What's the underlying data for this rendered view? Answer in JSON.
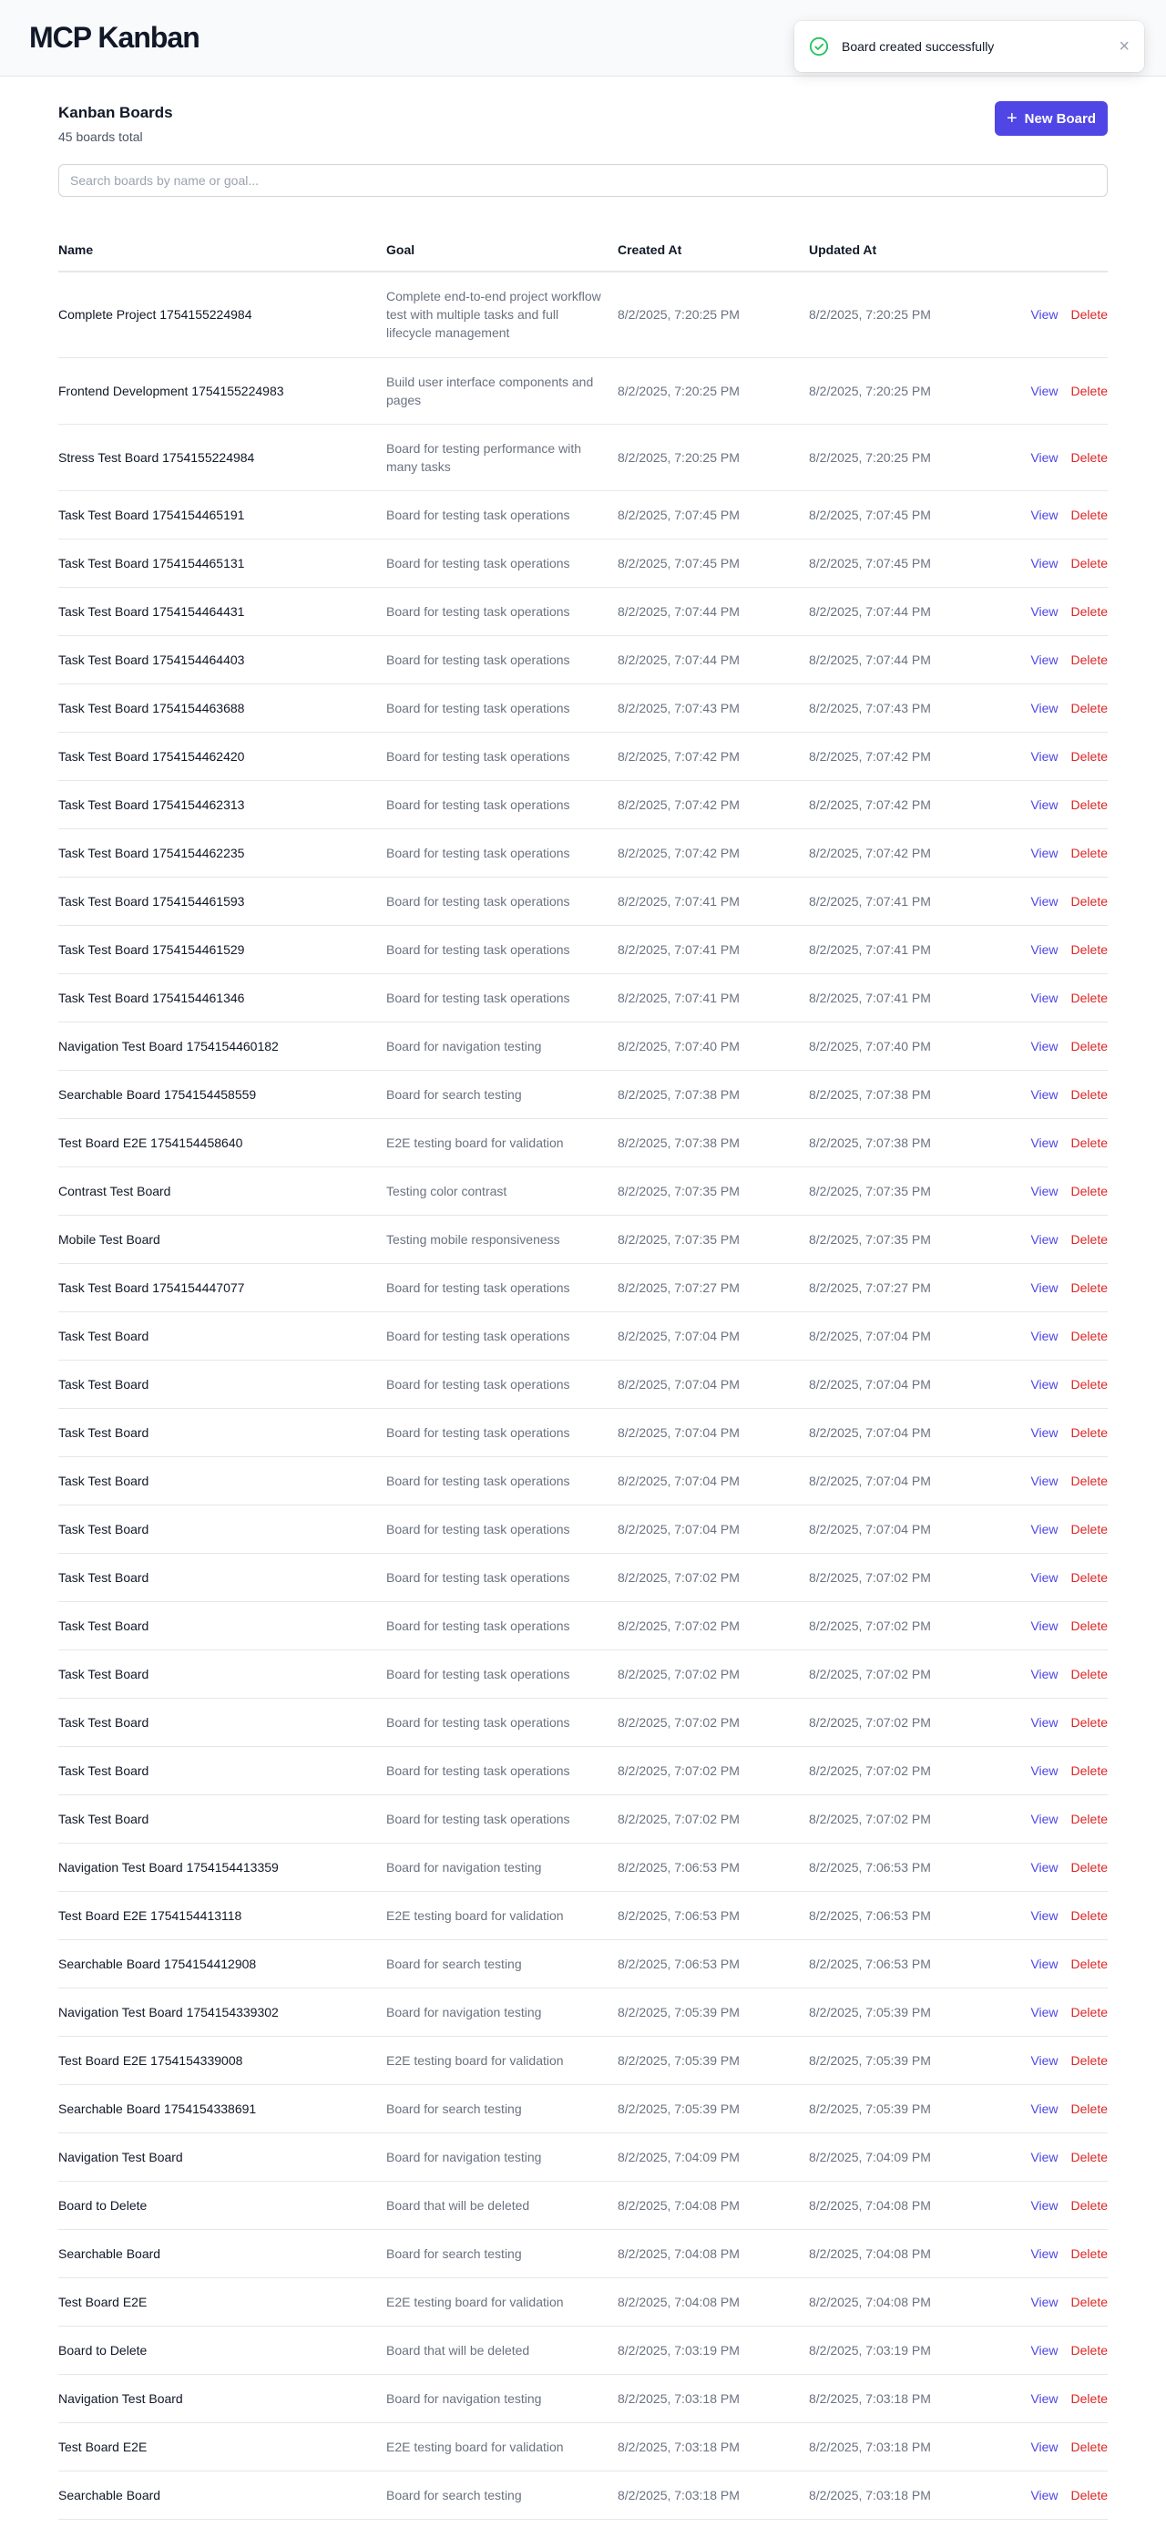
{
  "app": {
    "title": "MCP Kanban"
  },
  "toast": {
    "message": "Board created successfully",
    "close_symbol": "×"
  },
  "page": {
    "title": "Kanban Boards",
    "subtitle": "45 boards total",
    "new_board_label": "New Board"
  },
  "search": {
    "placeholder": "Search boards by name or goal..."
  },
  "table": {
    "columns": [
      "Name",
      "Goal",
      "Created At",
      "Updated At"
    ],
    "action_labels": {
      "view": "View",
      "delete": "Delete"
    },
    "rows": [
      {
        "name": "Complete Project 1754155224984",
        "goal": "Complete end-to-end project workflow test with multiple tasks and full lifecycle management",
        "created": "8/2/2025, 7:20:25 PM",
        "updated": "8/2/2025, 7:20:25 PM"
      },
      {
        "name": "Frontend Development 1754155224983",
        "goal": "Build user interface components and pages",
        "created": "8/2/2025, 7:20:25 PM",
        "updated": "8/2/2025, 7:20:25 PM"
      },
      {
        "name": "Stress Test Board 1754155224984",
        "goal": "Board for testing performance with many tasks",
        "created": "8/2/2025, 7:20:25 PM",
        "updated": "8/2/2025, 7:20:25 PM"
      },
      {
        "name": "Task Test Board 1754154465191",
        "goal": "Board for testing task operations",
        "created": "8/2/2025, 7:07:45 PM",
        "updated": "8/2/2025, 7:07:45 PM"
      },
      {
        "name": "Task Test Board 1754154465131",
        "goal": "Board for testing task operations",
        "created": "8/2/2025, 7:07:45 PM",
        "updated": "8/2/2025, 7:07:45 PM"
      },
      {
        "name": "Task Test Board 1754154464431",
        "goal": "Board for testing task operations",
        "created": "8/2/2025, 7:07:44 PM",
        "updated": "8/2/2025, 7:07:44 PM"
      },
      {
        "name": "Task Test Board 1754154464403",
        "goal": "Board for testing task operations",
        "created": "8/2/2025, 7:07:44 PM",
        "updated": "8/2/2025, 7:07:44 PM"
      },
      {
        "name": "Task Test Board 1754154463688",
        "goal": "Board for testing task operations",
        "created": "8/2/2025, 7:07:43 PM",
        "updated": "8/2/2025, 7:07:43 PM"
      },
      {
        "name": "Task Test Board 1754154462420",
        "goal": "Board for testing task operations",
        "created": "8/2/2025, 7:07:42 PM",
        "updated": "8/2/2025, 7:07:42 PM"
      },
      {
        "name": "Task Test Board 1754154462313",
        "goal": "Board for testing task operations",
        "created": "8/2/2025, 7:07:42 PM",
        "updated": "8/2/2025, 7:07:42 PM"
      },
      {
        "name": "Task Test Board 1754154462235",
        "goal": "Board for testing task operations",
        "created": "8/2/2025, 7:07:42 PM",
        "updated": "8/2/2025, 7:07:42 PM"
      },
      {
        "name": "Task Test Board 1754154461593",
        "goal": "Board for testing task operations",
        "created": "8/2/2025, 7:07:41 PM",
        "updated": "8/2/2025, 7:07:41 PM"
      },
      {
        "name": "Task Test Board 1754154461529",
        "goal": "Board for testing task operations",
        "created": "8/2/2025, 7:07:41 PM",
        "updated": "8/2/2025, 7:07:41 PM"
      },
      {
        "name": "Task Test Board 1754154461346",
        "goal": "Board for testing task operations",
        "created": "8/2/2025, 7:07:41 PM",
        "updated": "8/2/2025, 7:07:41 PM"
      },
      {
        "name": "Navigation Test Board 1754154460182",
        "goal": "Board for navigation testing",
        "created": "8/2/2025, 7:07:40 PM",
        "updated": "8/2/2025, 7:07:40 PM"
      },
      {
        "name": "Searchable Board 1754154458559",
        "goal": "Board for search testing",
        "created": "8/2/2025, 7:07:38 PM",
        "updated": "8/2/2025, 7:07:38 PM"
      },
      {
        "name": "Test Board E2E 1754154458640",
        "goal": "E2E testing board for validation",
        "created": "8/2/2025, 7:07:38 PM",
        "updated": "8/2/2025, 7:07:38 PM"
      },
      {
        "name": "Contrast Test Board",
        "goal": "Testing color contrast",
        "created": "8/2/2025, 7:07:35 PM",
        "updated": "8/2/2025, 7:07:35 PM"
      },
      {
        "name": "Mobile Test Board",
        "goal": "Testing mobile responsiveness",
        "created": "8/2/2025, 7:07:35 PM",
        "updated": "8/2/2025, 7:07:35 PM"
      },
      {
        "name": "Task Test Board 1754154447077",
        "goal": "Board for testing task operations",
        "created": "8/2/2025, 7:07:27 PM",
        "updated": "8/2/2025, 7:07:27 PM"
      },
      {
        "name": "Task Test Board",
        "goal": "Board for testing task operations",
        "created": "8/2/2025, 7:07:04 PM",
        "updated": "8/2/2025, 7:07:04 PM"
      },
      {
        "name": "Task Test Board",
        "goal": "Board for testing task operations",
        "created": "8/2/2025, 7:07:04 PM",
        "updated": "8/2/2025, 7:07:04 PM"
      },
      {
        "name": "Task Test Board",
        "goal": "Board for testing task operations",
        "created": "8/2/2025, 7:07:04 PM",
        "updated": "8/2/2025, 7:07:04 PM"
      },
      {
        "name": "Task Test Board",
        "goal": "Board for testing task operations",
        "created": "8/2/2025, 7:07:04 PM",
        "updated": "8/2/2025, 7:07:04 PM"
      },
      {
        "name": "Task Test Board",
        "goal": "Board for testing task operations",
        "created": "8/2/2025, 7:07:04 PM",
        "updated": "8/2/2025, 7:07:04 PM"
      },
      {
        "name": "Task Test Board",
        "goal": "Board for testing task operations",
        "created": "8/2/2025, 7:07:02 PM",
        "updated": "8/2/2025, 7:07:02 PM"
      },
      {
        "name": "Task Test Board",
        "goal": "Board for testing task operations",
        "created": "8/2/2025, 7:07:02 PM",
        "updated": "8/2/2025, 7:07:02 PM"
      },
      {
        "name": "Task Test Board",
        "goal": "Board for testing task operations",
        "created": "8/2/2025, 7:07:02 PM",
        "updated": "8/2/2025, 7:07:02 PM"
      },
      {
        "name": "Task Test Board",
        "goal": "Board for testing task operations",
        "created": "8/2/2025, 7:07:02 PM",
        "updated": "8/2/2025, 7:07:02 PM"
      },
      {
        "name": "Task Test Board",
        "goal": "Board for testing task operations",
        "created": "8/2/2025, 7:07:02 PM",
        "updated": "8/2/2025, 7:07:02 PM"
      },
      {
        "name": "Task Test Board",
        "goal": "Board for testing task operations",
        "created": "8/2/2025, 7:07:02 PM",
        "updated": "8/2/2025, 7:07:02 PM"
      },
      {
        "name": "Navigation Test Board 1754154413359",
        "goal": "Board for navigation testing",
        "created": "8/2/2025, 7:06:53 PM",
        "updated": "8/2/2025, 7:06:53 PM"
      },
      {
        "name": "Test Board E2E 1754154413118",
        "goal": "E2E testing board for validation",
        "created": "8/2/2025, 7:06:53 PM",
        "updated": "8/2/2025, 7:06:53 PM"
      },
      {
        "name": "Searchable Board 1754154412908",
        "goal": "Board for search testing",
        "created": "8/2/2025, 7:06:53 PM",
        "updated": "8/2/2025, 7:06:53 PM"
      },
      {
        "name": "Navigation Test Board 1754154339302",
        "goal": "Board for navigation testing",
        "created": "8/2/2025, 7:05:39 PM",
        "updated": "8/2/2025, 7:05:39 PM"
      },
      {
        "name": "Test Board E2E 1754154339008",
        "goal": "E2E testing board for validation",
        "created": "8/2/2025, 7:05:39 PM",
        "updated": "8/2/2025, 7:05:39 PM"
      },
      {
        "name": "Searchable Board 1754154338691",
        "goal": "Board for search testing",
        "created": "8/2/2025, 7:05:39 PM",
        "updated": "8/2/2025, 7:05:39 PM"
      },
      {
        "name": "Navigation Test Board",
        "goal": "Board for navigation testing",
        "created": "8/2/2025, 7:04:09 PM",
        "updated": "8/2/2025, 7:04:09 PM"
      },
      {
        "name": "Board to Delete",
        "goal": "Board that will be deleted",
        "created": "8/2/2025, 7:04:08 PM",
        "updated": "8/2/2025, 7:04:08 PM"
      },
      {
        "name": "Searchable Board",
        "goal": "Board for search testing",
        "created": "8/2/2025, 7:04:08 PM",
        "updated": "8/2/2025, 7:04:08 PM"
      },
      {
        "name": "Test Board E2E",
        "goal": "E2E testing board for validation",
        "created": "8/2/2025, 7:04:08 PM",
        "updated": "8/2/2025, 7:04:08 PM"
      },
      {
        "name": "Board to Delete",
        "goal": "Board that will be deleted",
        "created": "8/2/2025, 7:03:19 PM",
        "updated": "8/2/2025, 7:03:19 PM"
      },
      {
        "name": "Navigation Test Board",
        "goal": "Board for navigation testing",
        "created": "8/2/2025, 7:03:18 PM",
        "updated": "8/2/2025, 7:03:18 PM"
      },
      {
        "name": "Test Board E2E",
        "goal": "E2E testing board for validation",
        "created": "8/2/2025, 7:03:18 PM",
        "updated": "8/2/2025, 7:03:18 PM"
      },
      {
        "name": "Searchable Board",
        "goal": "Board for search testing",
        "created": "8/2/2025, 7:03:18 PM",
        "updated": "8/2/2025, 7:03:18 PM"
      }
    ]
  },
  "colors": {
    "accent": "#4f46e5",
    "danger": "#dc2626",
    "success": "#22c55e",
    "muted_text": "#6b7280"
  },
  "icons": {
    "toast": "check-circle-icon",
    "toast_close": "close-icon",
    "new_board": "plus-icon"
  }
}
